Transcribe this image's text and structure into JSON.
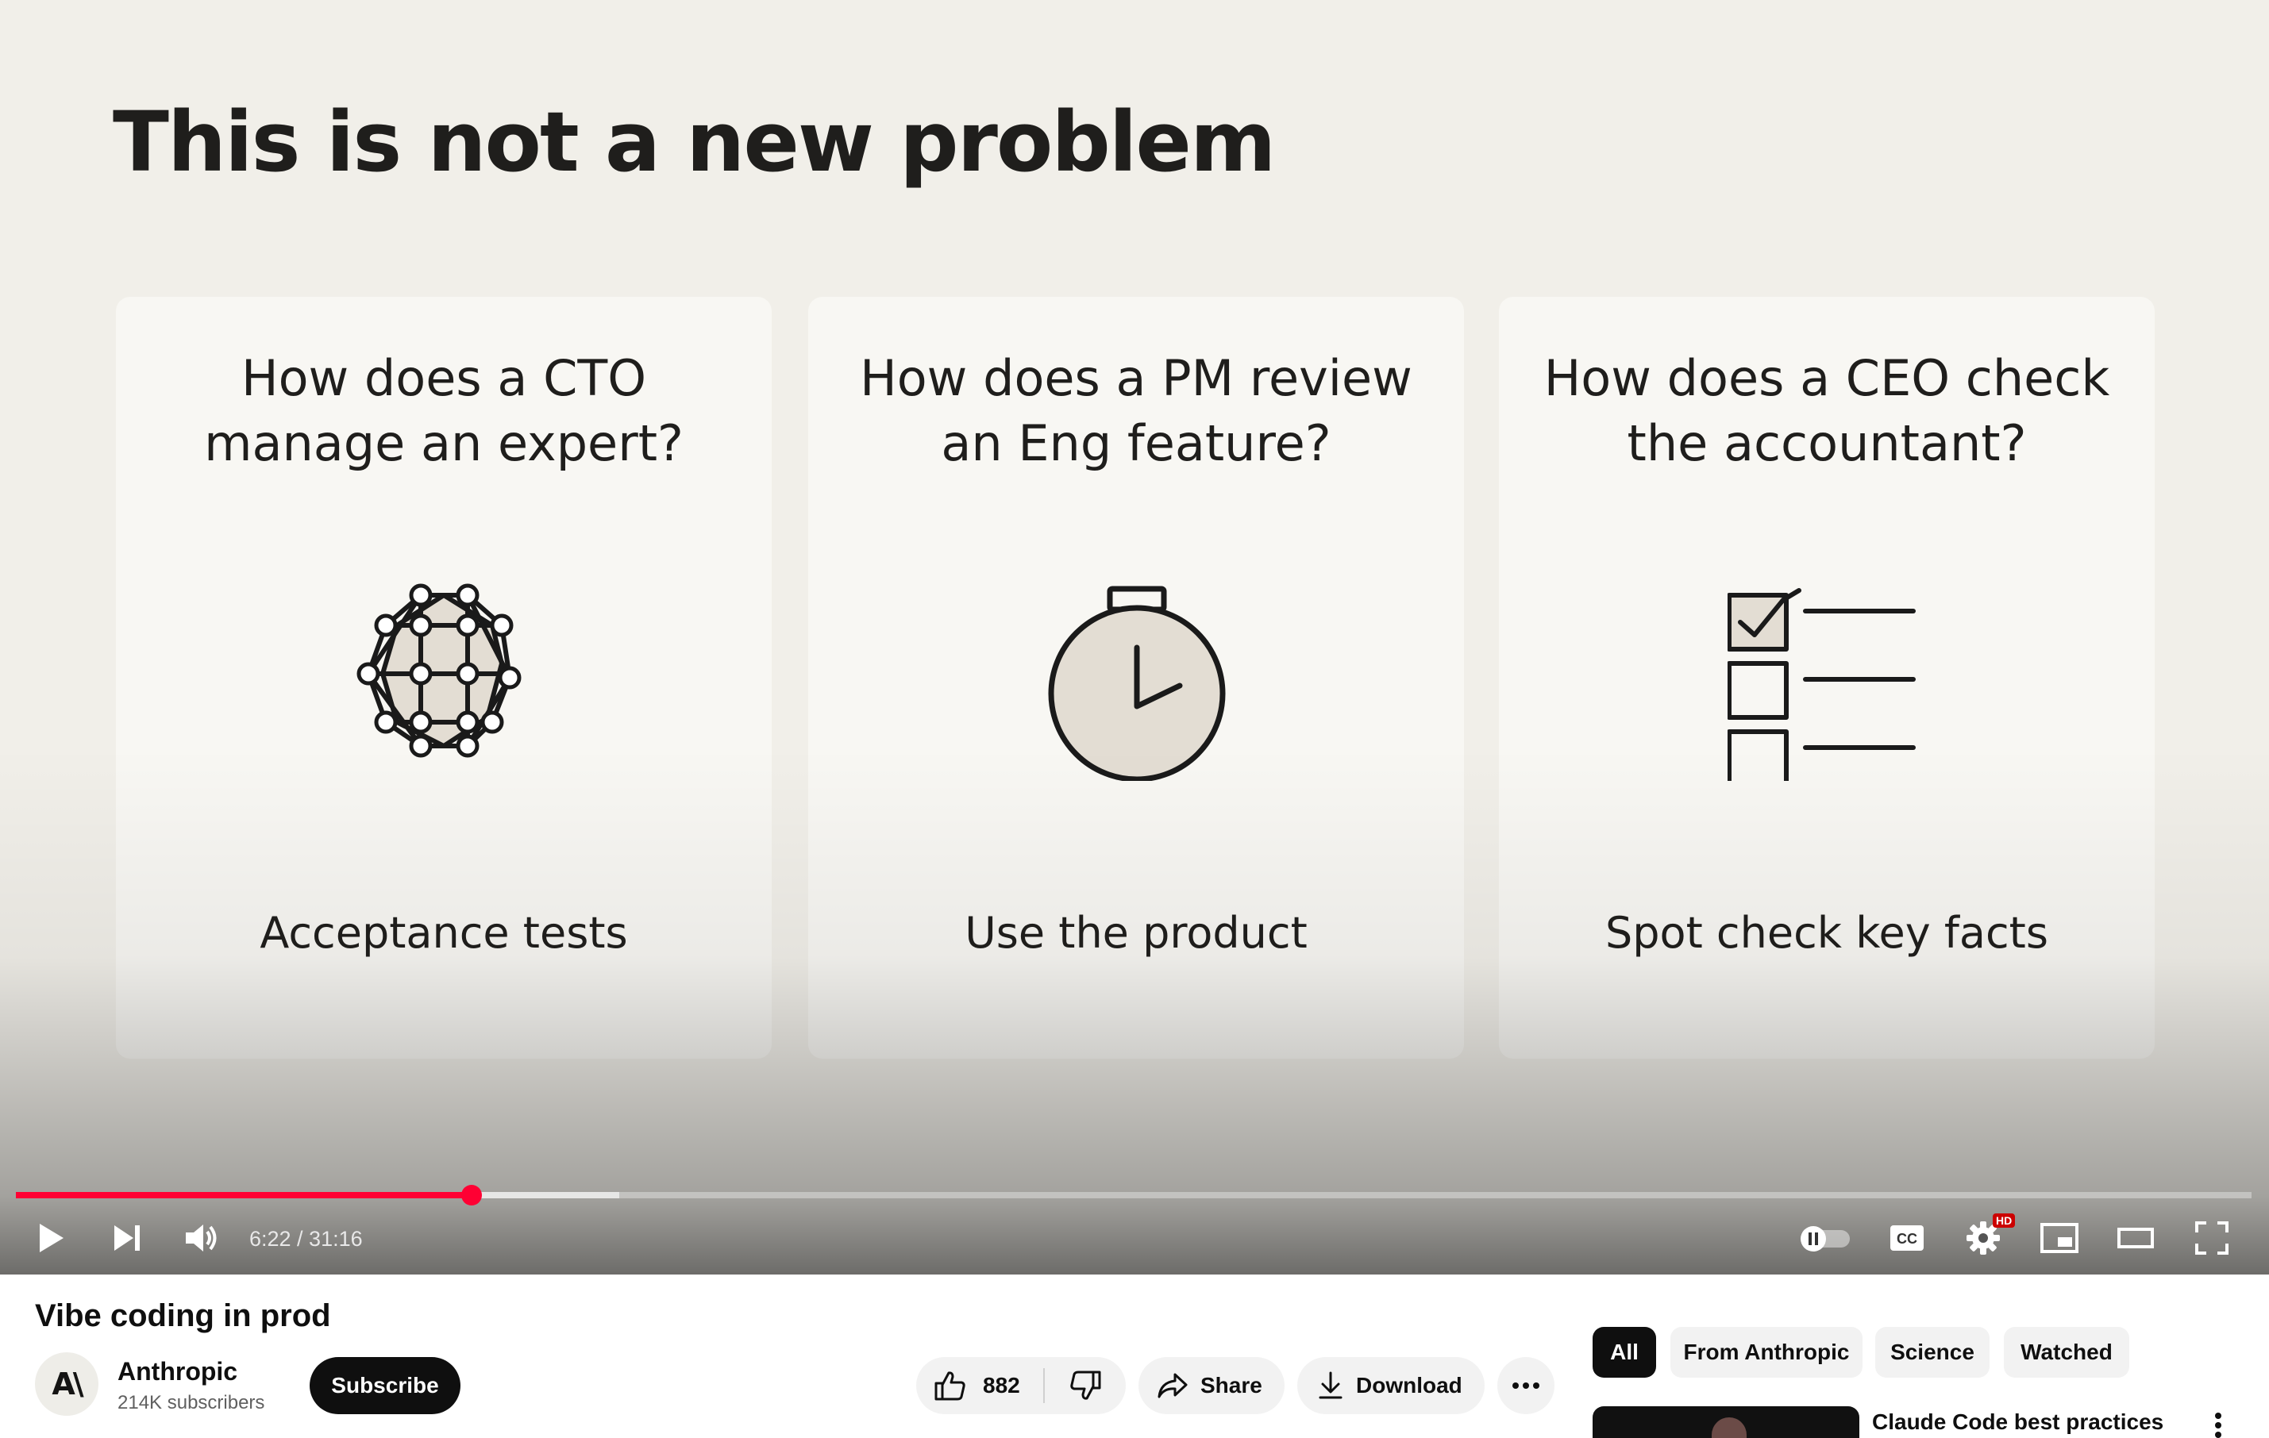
{
  "video": {
    "slide": {
      "title": "This is not a new problem",
      "cards": [
        {
          "question": "How does a CTO\nmanage an expert?",
          "answer": "Acceptance tests",
          "icon": "network-grid-icon"
        },
        {
          "question": "How does a PM review\nan Eng feature?",
          "answer": "Use the product",
          "icon": "stopwatch-icon"
        },
        {
          "question": "How does a CEO check\nthe accountant?",
          "answer": "Spot check key facts",
          "icon": "checklist-icon"
        }
      ]
    },
    "progress": {
      "played_fraction": 0.204,
      "buffered_fraction": 0.27
    },
    "time_display": "6:22 / 31:16",
    "hd_badge": "HD",
    "accent_color": "#ff0033"
  },
  "details": {
    "title": "Vibe coding in prod",
    "channel": {
      "name": "Anthropic",
      "subscribers": "214K subscribers",
      "logo_text": "A\\"
    },
    "subscribe_label": "Subscribe",
    "like_count": "882",
    "share_label": "Share",
    "download_label": "Download"
  },
  "sidebar": {
    "chips": [
      {
        "label": "All",
        "active": true
      },
      {
        "label": "From Anthropic",
        "active": false
      },
      {
        "label": "Science",
        "active": false
      },
      {
        "label": "Watched",
        "active": false
      }
    ],
    "recommendations": [
      {
        "title": "Claude Code best practices"
      }
    ]
  }
}
